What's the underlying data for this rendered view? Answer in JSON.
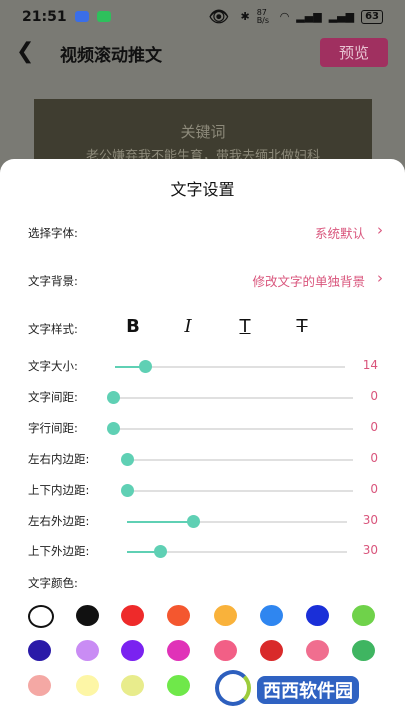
{
  "status_bar": {
    "time": "21:51",
    "net_speed": "87 B/s",
    "battery": "63"
  },
  "app_bar": {
    "title": "视频滚动推文",
    "preview_label": "预览"
  },
  "preview": {
    "keyword": "关键词",
    "scroll_text": "老公嫌弃我不能生育，带我去缅北做妇科"
  },
  "sheet": {
    "title": "文字设置",
    "font_row": {
      "label": "选择字体:",
      "value": "系统默认"
    },
    "background_row": {
      "label": "文字背景:",
      "value": "修改文字的单独背景"
    },
    "style_row": {
      "label": "文字样式:",
      "buttons": [
        "B",
        "I",
        "T",
        "T"
      ]
    },
    "sliders": [
      {
        "label": "文字大小:",
        "value": "14",
        "level": 0.13
      },
      {
        "label": "文字间距:",
        "value": "0",
        "level": 0.0
      },
      {
        "label": "字行间距:",
        "value": "0",
        "level": 0.0
      },
      {
        "label": "左右内边距:",
        "value": "0",
        "level": 0.0
      },
      {
        "label": "上下内边距:",
        "value": "0",
        "level": 0.0
      },
      {
        "label": "左右外边距:",
        "value": "30",
        "level": 0.3
      },
      {
        "label": "上下外边距:",
        "value": "30",
        "level": 0.15
      }
    ],
    "color_label": "文字颜色:",
    "colors": [
      "#ffffff",
      "#111111",
      "#ee2a2a",
      "#f4572f",
      "#f9b23b",
      "#2f86f0",
      "#1a2fd8",
      "#6fd24a",
      "#2a1aa8",
      "#c98cf4",
      "#7a22f0",
      "#e032b8",
      "#f25f86",
      "#d92a2a",
      "#f06e8f",
      "#3fb561",
      "#f4a8a4",
      "#fdf6a6",
      "#e8ec8c",
      "#6fe84a"
    ]
  },
  "watermark": {
    "text": "西西软件园"
  }
}
